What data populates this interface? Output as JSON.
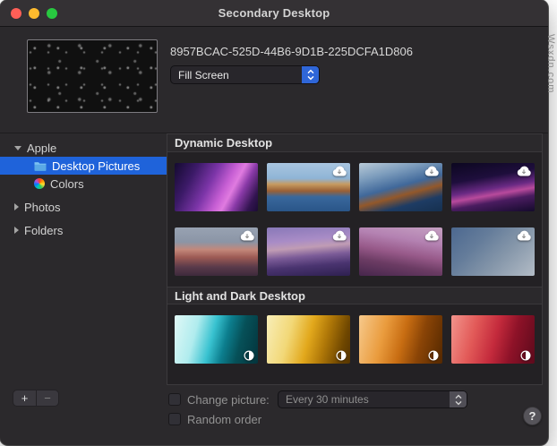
{
  "window": {
    "title": "Secondary Desktop"
  },
  "watermark": "Wsxdn.com",
  "preview": {
    "image_name": "8957BCAC-525D-44B6-9D1B-225DCFA1D806",
    "scaling_value": "Fill Screen"
  },
  "sidebar": {
    "apple_group": "Apple",
    "desktop_pictures": "Desktop Pictures",
    "colors": "Colors",
    "photos": "Photos",
    "folders": "Folders"
  },
  "sections": [
    {
      "title": "Dynamic Desktop",
      "thumbs": [
        {
          "name": "monterey",
          "badge": null,
          "bg": "linear-gradient(118deg,#140a30 0%,#3c1a68 22%,#7c35a8 42%,#c75fd4 58%,#e07be0 66%,#8a3aa8 76%,#321450 90%,#1a0c34 100%)"
        },
        {
          "name": "catalina-day",
          "badge": "cloud",
          "bg": "linear-gradient(180deg,#a9c6e0 0%,#8fb4d6 32%,#c79a60 44%,#996036 58%,#39689c 70%,#2a5588 100%)"
        },
        {
          "name": "catalina-evening",
          "badge": "cloud",
          "bg": "linear-gradient(165deg,#b9cbd8 0%,#7c9cbc 25%,#40689a 48%,#93582a 62%,#1e3c64 78%,#16304f 100%)"
        },
        {
          "name": "purple-ridge",
          "badge": "cloud",
          "bg": "linear-gradient(170deg,#0c0720 0%,#1e0e3c 32%,#6a2a84 52%,#b84a9c 62%,#4a1c60 74%,#140a2c 100%)"
        },
        {
          "name": "pink-cliffs",
          "badge": "cloud",
          "bg": "linear-gradient(180deg,#98a2b2 0%,#8b95a6 30%,#c3887a 46%,#9c5a54 62%,#593a4a 82%,#3e2a3c 100%)"
        },
        {
          "name": "purple-coast",
          "badge": "cloud",
          "bg": "linear-gradient(175deg,#8878b8 0%,#a98cc6 28%,#c09cb4 42%,#7c5c98 58%,#4a3470 76%,#2e2050 100%)"
        },
        {
          "name": "desert-dusk",
          "badge": "cloud",
          "bg": "linear-gradient(190deg,#c5a0c2 0%,#b482b2 28%,#985a8a 52%,#6c3c64 72%,#46264c 100%)"
        },
        {
          "name": "blue-gradient",
          "badge": "cloud",
          "bg": "linear-gradient(135deg,#4c6890 0%,#647c9a 32%,#8697aa 62%,#b3bcc6 100%)"
        }
      ]
    },
    {
      "title": "Light and Dark Desktop",
      "thumbs": [
        {
          "name": "abstract-teal",
          "badge": "dynamic",
          "bg": "linear-gradient(105deg,#e0f8f6 0%,#b0ecee 26%,#38c2d0 45%,#0c7e8e 60%,#065058 76%,#03343c 100%)"
        },
        {
          "name": "abstract-yellow",
          "badge": "dynamic",
          "bg": "linear-gradient(105deg,#f8eeb8 0%,#f2d878 28%,#e2a81c 50%,#b07808 68%,#6e4600 88%,#553400 100%)"
        },
        {
          "name": "abstract-orange",
          "badge": "dynamic",
          "bg": "linear-gradient(105deg,#f6c98c 0%,#ea9c3e 30%,#c86d12 52%,#8a4406 72%,#542800 100%)"
        },
        {
          "name": "abstract-red",
          "badge": "dynamic",
          "bg": "linear-gradient(105deg,#f2948c 0%,#e25a58 28%,#c42a3c 52%,#8e1228 72%,#5c0a1c 100%)"
        }
      ]
    }
  ],
  "footer": {
    "add": "+",
    "remove": "−",
    "change_picture": "Change picture:",
    "interval": "Every 30 minutes",
    "random_order": "Random order",
    "help": "?"
  },
  "colors": {
    "selection_blue": "#1f63da",
    "stepper_blue": "#2f66d8"
  }
}
